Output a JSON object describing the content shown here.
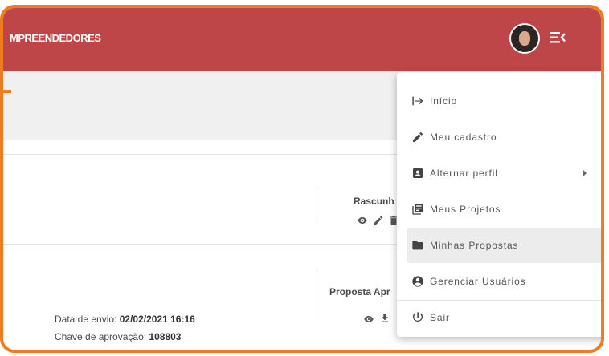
{
  "header": {
    "brand": "MPREENDEDORES",
    "colors": {
      "bar": "#bf4648",
      "frame": "#f07c22"
    }
  },
  "cards": [
    {
      "status": "Rascunh"
    },
    {
      "status": "Proposta Apr",
      "sent_label": "Data de envio:",
      "sent_value": "02/02/2021 16:16",
      "key_label": "Chave de aprovação:",
      "key_value": "108803"
    }
  ],
  "menu": {
    "items": [
      {
        "label": "Início",
        "icon": "login-arrow-icon"
      },
      {
        "label": "Meu cadastro",
        "icon": "pencil-icon"
      },
      {
        "label": "Alternar perfil",
        "icon": "id-card-icon",
        "has_submenu": true
      },
      {
        "label": "Meus Projetos",
        "icon": "library-books-icon"
      },
      {
        "label": "Minhas Propostas",
        "icon": "folder-icon",
        "active": true
      },
      {
        "label": "Gerenciar Usuários",
        "icon": "account-circle-icon"
      },
      {
        "label": "Sair",
        "icon": "power-icon"
      }
    ]
  }
}
